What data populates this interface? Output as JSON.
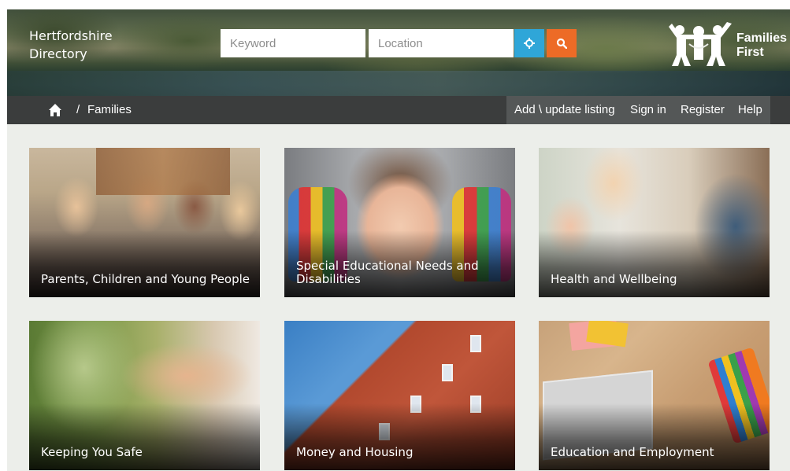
{
  "header": {
    "site_title": "Hertfordshire Directory",
    "keyword_placeholder": "Keyword",
    "location_placeholder": "Location",
    "locate_icon": "crosshair-icon",
    "search_icon": "search-icon",
    "logo_text_line1": "Families",
    "logo_text_line2": "First"
  },
  "navbar": {
    "home_icon": "home-icon",
    "breadcrumb_separator": "/",
    "breadcrumb_current": "Families",
    "links": [
      "Add \\ update listing",
      "Sign in",
      "Register",
      "Help"
    ]
  },
  "tiles": [
    {
      "label": "Parents, Children and Young People"
    },
    {
      "label": "Special Educational Needs and Disabilities"
    },
    {
      "label": "Health and Wellbeing"
    },
    {
      "label": "Keeping You Safe"
    },
    {
      "label": "Money and Housing"
    },
    {
      "label": "Education and Employment"
    }
  ],
  "colors": {
    "navbar": "#3b3d3d",
    "navbar_right": "#545757",
    "locate_button": "#2fa6d8",
    "search_button": "#ed6b26",
    "page_background": "#eceeea"
  }
}
